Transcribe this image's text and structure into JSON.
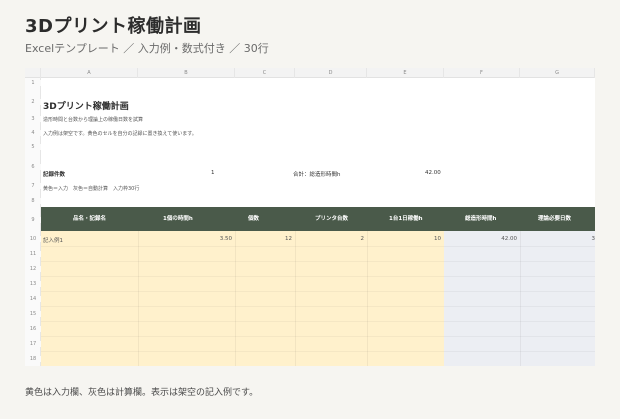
{
  "page": {
    "title": "3Dプリント稼働計画",
    "subtitle": "Excelテンプレート ／ 入力例・数式付き ／ 30行",
    "footer": "黄色は入力欄、灰色は計算欄。表示は架空の記入例です。"
  },
  "sheet": {
    "columns": [
      "A",
      "B",
      "C",
      "D",
      "E",
      "F",
      "G"
    ],
    "rows": [
      "1",
      "2",
      "3",
      "4",
      "5",
      "6",
      "7",
      "8",
      "9",
      "10",
      "11",
      "12",
      "13",
      "14",
      "15",
      "16",
      "17",
      "18"
    ],
    "sheet_title": "3Dプリント稼働計画",
    "desc1": "造形時間と台数から理論上の稼働日数を試算",
    "desc2": "入力例は架空です。黄色のセルを自分の記録に置き換えて使います。",
    "record_count_label": "記録件数",
    "record_count_value": "1",
    "total_hours_label": "合計：総造形時間h",
    "total_hours_value": "42.00",
    "legend_text": "黄色＝入力　灰色＝自動計算　入力枠30行",
    "headers": [
      "品名・記録名",
      "1個の時間h",
      "個数",
      "プリンタ台数",
      "1台1日稼働h",
      "総造形時間h",
      "理論必要日数"
    ],
    "example_row": {
      "name": "記入例1",
      "time": "3.50",
      "qty": "12",
      "printers": "2",
      "daily_hours": "10",
      "total": "42.00",
      "days": "3"
    }
  },
  "colors": {
    "header_band": "#4a5a4a",
    "input_fill": "#fff1cc",
    "calc_fill": "#eceef3"
  }
}
